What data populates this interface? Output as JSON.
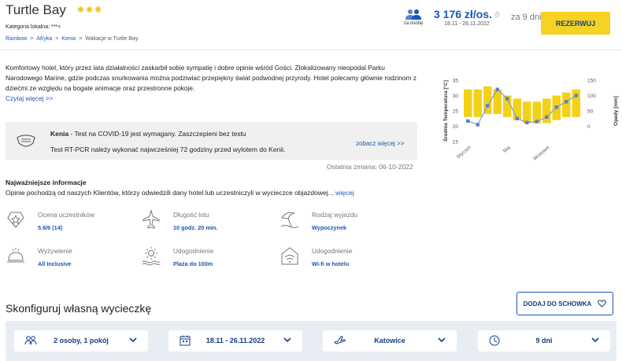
{
  "header": {
    "title": "Turtle Bay",
    "stars_count": 3,
    "category": "Kategoria lokalna: ***+",
    "breadcrumb": [
      {
        "label": "Rainbow",
        "link": true
      },
      {
        "label": "Afryka",
        "link": true
      },
      {
        "label": "Kenia",
        "link": true
      },
      {
        "label": "Wakacje w Turtle Bay",
        "link": false
      }
    ],
    "persons_label": "za osobę",
    "price": "3 176 zł/os.",
    "price_dates": "18.11 - 26.11.2022",
    "days_label": "za 9 dni",
    "reserve_label": "REZERWUJ"
  },
  "description": {
    "text": "Komfortowy hotel, który przez lata działalności zaskarbił sobie sympatię i dobre opinie wśród Gości. Zlokalizowany nieopodal Parku Narodowego Marine, gdzie podczas snurkowania można podziwiać przepiękny świat podwodnej przyrody. Hotel polecamy głównie rodzinom z dziećmi ze względu na bogate animacje oraz przestronne pokoje.",
    "read_more": "Czytaj więcej >>"
  },
  "covid": {
    "country": "Kenia",
    "line1_rest": " - Test na COVID-19 jest wymagany. Zaszczepieni bez testu",
    "line2": "Test RT-PCR należy wykonać najwcześniej 72 godziny przed wylotem do Kenii.",
    "more": "zobacz więcej >>",
    "last_change": "Ostatnia zmiana: 06-10-2022"
  },
  "key_info": {
    "title": "Najważniejsze informacje",
    "desc": "Opinie pochodzą od naszych Klientów, którzy odwiedzili dany hotel lub uczestniczyli w wycieczce objazdowej...",
    "more": "więcej",
    "items": [
      {
        "label": "Ocena uczestników",
        "value": "5.6/6 (14)",
        "icon": "rating-star-icon"
      },
      {
        "label": "Długość lotu",
        "value": "10 godz. 20 min.",
        "icon": "airplane-icon"
      },
      {
        "label": "Rodzaj wyjazdu",
        "value": "Wypoczynek",
        "icon": "beach-umbrella-icon"
      },
      {
        "label": "Wyżywienie",
        "value": "All Inclusive",
        "icon": "meal-bell-icon"
      },
      {
        "label": "Udogodnienie",
        "value": "Plaża do 100m",
        "icon": "sun-sea-icon"
      },
      {
        "label": "Udogodnienie",
        "value": "Wi-fi w hotelu",
        "icon": "wifi-house-icon"
      }
    ]
  },
  "chart_data": {
    "type": "bar",
    "title": "",
    "ylabel_left": "Średnia Temperatura [°C]",
    "ylabel_right": "Opady [mm]",
    "x_tick_labels": [
      "Styczeń",
      "Maj",
      "Wrzesień"
    ],
    "x_tick_indices": [
      0,
      4,
      8
    ],
    "left_ylim": [
      15,
      35
    ],
    "left_ticks": [
      15,
      20,
      25,
      30,
      35
    ],
    "right_ylim": [
      -50,
      150
    ],
    "right_ticks": [
      0,
      50,
      100,
      150
    ],
    "temp_min": [
      23,
      23,
      24,
      24,
      23,
      22,
      21,
      21,
      21,
      22,
      23,
      23
    ],
    "temp_max": [
      32,
      32,
      33,
      32,
      30,
      29,
      28,
      28,
      29,
      30,
      31,
      32
    ],
    "precipitation": [
      17,
      5,
      67,
      120,
      90,
      25,
      12,
      15,
      30,
      62,
      80,
      100
    ],
    "colors": {
      "bars": "#f3d117",
      "line": "#7c9cdc",
      "marker": "#5a7fd0"
    }
  },
  "config": {
    "title": "Skonfiguruj własną wycieczkę",
    "add_label": "DODAJ DO SCHOWKA",
    "fields": [
      {
        "value": "2 osoby, 1 pokój",
        "icon": "people-icon"
      },
      {
        "value": "18.11 - 26.11.2022",
        "icon": "calendar-icon"
      },
      {
        "value": "Katowice",
        "icon": "plane-departure-icon"
      },
      {
        "value": "9 dni",
        "icon": "clock-icon"
      }
    ]
  }
}
